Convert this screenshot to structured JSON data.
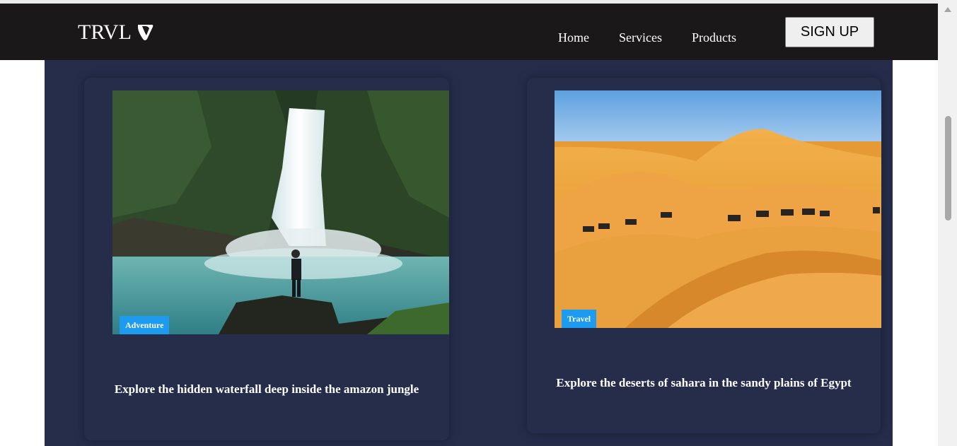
{
  "brand": {
    "name": "TRVL",
    "logo_icon": "typo3-logo-icon"
  },
  "nav": {
    "links": [
      "Home",
      "Services",
      "Products"
    ],
    "signup_label": "SIGN UP"
  },
  "cards": [
    {
      "badge": "Adventure",
      "caption": "Explore the hidden waterfall deep inside the amazon jungle",
      "image": "waterfall-photo"
    },
    {
      "badge": "Travel",
      "caption": "Explore the deserts of sahara in the sandy plains of Egypt",
      "image": "desert-camels-photo"
    }
  ],
  "colors": {
    "navbar": "#1a1818",
    "page_panel": "#252d4b",
    "badge": "#1d9bf0",
    "text": "#ffffff"
  }
}
